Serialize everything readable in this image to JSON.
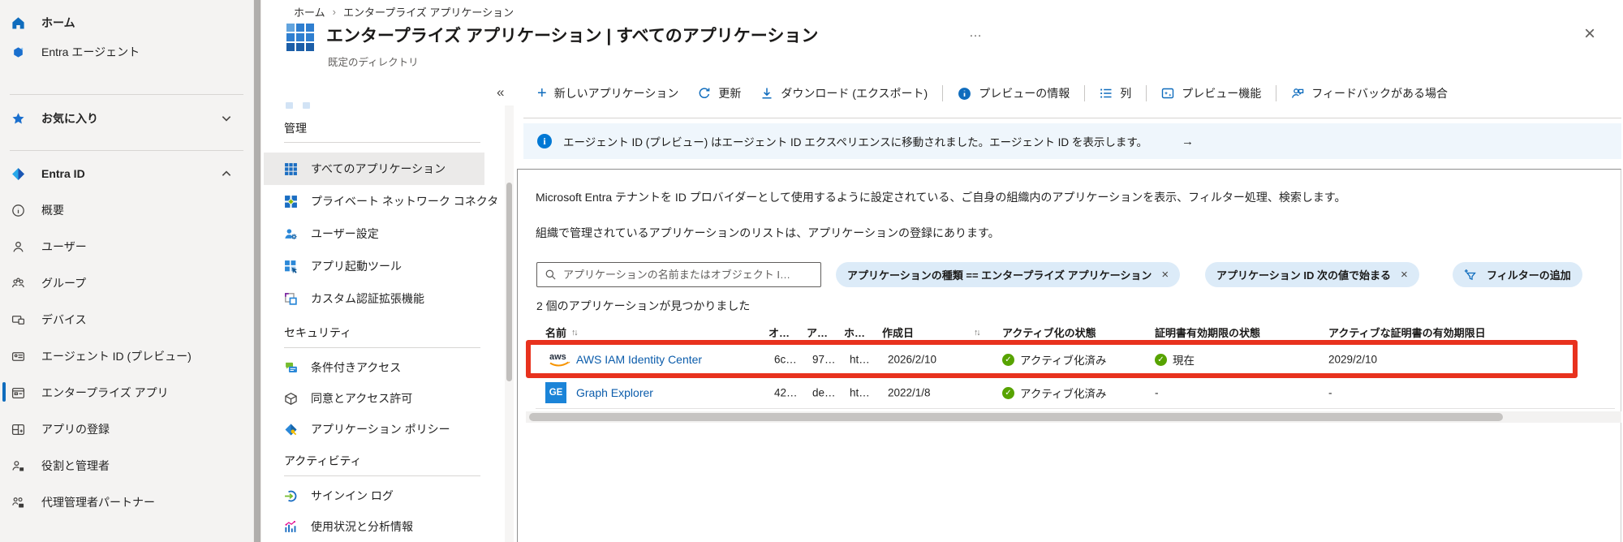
{
  "icons": {
    "close": "×",
    "more": "…",
    "collapse": "«",
    "breadcrumb_separator": "›",
    "sort": "↑↓",
    "arrow": "→",
    "check": "✓",
    "pill_close": "×",
    "plus": "+"
  },
  "breadcrumb": {
    "home": "ホーム",
    "current": "エンタープライズ アプリケーション"
  },
  "header": {
    "title": "エンタープライズ アプリケーション | すべてのアプリケーション",
    "subtitle": "既定のディレクトリ"
  },
  "left_nav": {
    "items": [
      {
        "label": "ホーム"
      },
      {
        "label": "Entra エージェント"
      },
      {
        "label": "お気に入り"
      },
      {
        "label": "Entra ID"
      },
      {
        "label": "概要"
      },
      {
        "label": "ユーザー"
      },
      {
        "label": "グループ"
      },
      {
        "label": "デバイス"
      },
      {
        "label": "エージェント ID (プレビュー)"
      },
      {
        "label": "エンタープライズ アプリ"
      },
      {
        "label": "アプリの登録"
      },
      {
        "label": "役割と管理者"
      },
      {
        "label": "代理管理者パートナー"
      }
    ]
  },
  "menu": {
    "selected_item": "すべてのアプリケーション",
    "sections": [
      {
        "header": "管理",
        "items": [
          "すべてのアプリケーション",
          "プライベート ネットワーク コネクタ",
          "ユーザー設定",
          "アプリ起動ツール",
          "カスタム認証拡張機能"
        ]
      },
      {
        "header": "セキュリティ",
        "items": [
          "条件付きアクセス",
          "同意とアクセス許可",
          "アプリケーション ポリシー"
        ]
      },
      {
        "header": "アクティビティ",
        "items": [
          "サインイン ログ",
          "使用状況と分析情報"
        ]
      }
    ]
  },
  "toolbar": {
    "new_app": "新しいアプリケーション",
    "refresh": "更新",
    "download": "ダウンロード (エクスポート)",
    "preview_info": "プレビューの情報",
    "columns": "列",
    "preview_features": "プレビュー機能",
    "feedback": "フィードバックがある場合"
  },
  "banner": {
    "message": "エージェント ID (プレビュー) はエージェント ID エクスペリエンスに移動されました。エージェント ID を表示します。"
  },
  "content": {
    "description_1": "Microsoft Entra テナントを ID プロバイダーとして使用するように設定されている、ご自身の組織内のアプリケーションを表示、フィルター処理、検索します。",
    "description_2": "組織で管理されているアプリケーションのリストは、アプリケーションの登録にあります。",
    "search_placeholder": "アプリケーションの名前またはオブジェクト I…",
    "filter_1": "アプリケーションの種類 == エンタープライズ アプリケーション",
    "filter_2": "アプリケーション ID 次の値で始まる",
    "add_filter": "フィルターの追加",
    "result_count": "2 個のアプリケーションが見つかりました"
  },
  "table": {
    "headers": {
      "name": "名前",
      "object_id": "オ…",
      "app_id": "ア…",
      "homepage": "ホ…",
      "created": "作成日",
      "activation": "アクティブ化の状態",
      "cert_status": "証明書有効期限の状態",
      "cert_expiry": "アクティブな証明書の有効期限日"
    },
    "rows": [
      {
        "icon_label": "aws",
        "name": "AWS IAM Identity Center",
        "object_id": "6c…",
        "app_id": "97…",
        "homepage": "ht…",
        "created": "2026/2/10",
        "activation": "アクティブ化済み",
        "cert_status": "現在",
        "cert_expiry": "2029/2/10"
      },
      {
        "icon_label": "GE",
        "name": "Graph Explorer",
        "object_id": "42…",
        "app_id": "de…",
        "homepage": "ht…",
        "created": "2022/1/8",
        "activation": "アクティブ化済み",
        "cert_status": "-",
        "cert_expiry": "-"
      }
    ]
  },
  "colors": {
    "accent": "#0f6cbd",
    "link": "#0b5cab",
    "banner_bg": "#eff6fc",
    "pill_bg": "#dcebf8",
    "status_green": "#57a300",
    "highlight_red": "#e8321e",
    "nav_bg": "#f4f3f2"
  }
}
